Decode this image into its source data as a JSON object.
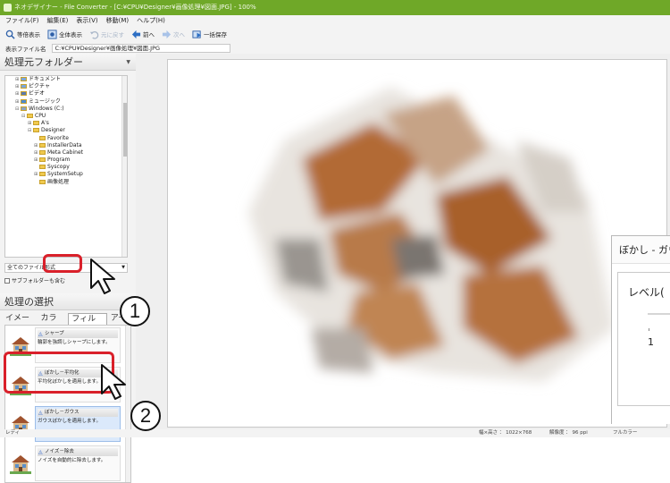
{
  "titlebar": {
    "title": "ネオデザイナー - File Converter - [C:¥CPU¥Designer¥画像処理¥図面.JPG] - 100%"
  },
  "menu": [
    "ファイル(F)",
    "編集(E)",
    "表示(V)",
    "移動(M)",
    "ヘルプ(H)"
  ],
  "toolbar": {
    "fit": "等倍表示",
    "whole": "全体表示",
    "undo": "元に戻す",
    "prev": "前へ",
    "next": "次へ",
    "saveall": "一括保存"
  },
  "pathbar": {
    "label": "表示ファイル名",
    "value": "C:¥CPU¥Designer¥画像処理¥図面.JPG"
  },
  "source_panel": {
    "title": "処理元フォルダー",
    "tree": [
      {
        "label": "ドキュメント",
        "indent": 1,
        "expander": "+",
        "color": "#7aa7de"
      },
      {
        "label": "ピクチャ",
        "indent": 1,
        "expander": "+",
        "color": "#7aa7de"
      },
      {
        "label": "ビデオ",
        "indent": 1,
        "expander": "+",
        "color": "#5b7ab0"
      },
      {
        "label": "ミュージック",
        "indent": 1,
        "expander": "+",
        "color": "#4c8bd1"
      },
      {
        "label": "Windows (C:)",
        "indent": 1,
        "expander": "−",
        "color": "#8aa3c4"
      },
      {
        "label": "CPU",
        "indent": 2,
        "expander": "−",
        "color": "#f0c94e"
      },
      {
        "label": "A's",
        "indent": 3,
        "expander": "+",
        "color": "#f0c94e"
      },
      {
        "label": "Designer",
        "indent": 3,
        "expander": "−",
        "color": "#f0c94e"
      },
      {
        "label": "Favorite",
        "indent": 4,
        "expander": "",
        "color": "#f0c94e"
      },
      {
        "label": "InstallerData",
        "indent": 4,
        "expander": "+",
        "color": "#f0c94e"
      },
      {
        "label": "Meta Cabinet",
        "indent": 4,
        "expander": "+",
        "color": "#f0c94e"
      },
      {
        "label": "Program",
        "indent": 4,
        "expander": "+",
        "color": "#f0c94e"
      },
      {
        "label": "Syscopy",
        "indent": 4,
        "expander": "",
        "color": "#f0c94e"
      },
      {
        "label": "SystemSetup",
        "indent": 4,
        "expander": "+",
        "color": "#f0c94e"
      },
      {
        "label": "画像処理",
        "indent": 4,
        "expander": "",
        "color": "#f0c94e"
      }
    ],
    "filetype": "全てのファイル形式",
    "subfolder": "サブフォルダーも含む"
  },
  "process_panel": {
    "title": "処理の選択",
    "tabs": [
      "イメージ",
      "カラー",
      "フィルタ",
      "アート"
    ],
    "active_tab": "フィルタ",
    "filters": [
      {
        "title": "シャープ",
        "desc": "輪郭を強調しシャープにします。",
        "selected": false
      },
      {
        "title": "ぼかし－平均化",
        "desc": "平均化ぼかしを適用します。",
        "selected": false
      },
      {
        "title": "ぼかし－ガウス",
        "desc": "ガウスぼかしを適用します。",
        "selected": true
      },
      {
        "title": "ノイズ－除去",
        "desc": "ノイズを自動的に除去します。",
        "selected": false
      }
    ]
  },
  "dialog": {
    "title": "ぼかし - ガウス",
    "group": "レベル(",
    "slider_value": "1"
  },
  "statusbar": {
    "ready": "レディ",
    "size": "幅×高さ ： 1022×768",
    "dpi": "解像度 ： 96 ppi",
    "color": "フルカラー"
  },
  "callouts": {
    "one": "1",
    "two": "2"
  },
  "colors": {
    "title_green": "#6fa828",
    "callout_red": "#d9202a",
    "selected_blue": "#dbe9fb"
  }
}
